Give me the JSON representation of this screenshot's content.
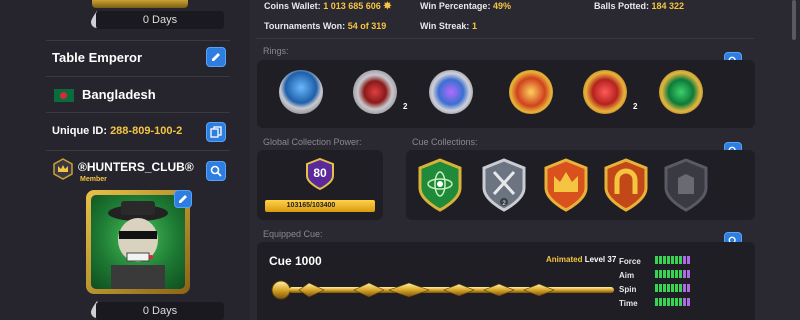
{
  "profile": {
    "days_top": "0 Days",
    "name": "Table Emperor",
    "country": "Bangladesh",
    "unique_id_label": "Unique ID:",
    "unique_id": "288-809-100-2",
    "club_name": "®HUNTERS_CLUB®",
    "club_role": "Member",
    "days_bottom": "0 Days"
  },
  "stats": {
    "coins_label": "Coins Wallet:",
    "coins_value": "1 013 685 606",
    "win_pct_label": "Win Percentage:",
    "win_pct_value": "49%",
    "balls_label": "Balls Potted:",
    "balls_value": "184 322",
    "tourn_label": "Tournaments Won:",
    "tourn_value": "54 of 319",
    "streak_label": "Win Streak:",
    "streak_value": "1"
  },
  "sections": {
    "rings": "Rings:",
    "power": "Global Collection Power:",
    "cue_collections": "Cue Collections:",
    "equipped_cue": "Equipped Cue:"
  },
  "rings": [
    {
      "name": "ring-8ball",
      "count": ""
    },
    {
      "name": "ring-silver",
      "count": "2"
    },
    {
      "name": "ring-galaxy",
      "count": ""
    },
    {
      "name": "ring-gold-dice",
      "count": ""
    },
    {
      "name": "ring-gold-heart",
      "count": "2"
    },
    {
      "name": "ring-emerald",
      "count": ""
    }
  ],
  "power": {
    "level": "80",
    "progress_text": "103165/103400",
    "progress": 0.998
  },
  "cue": {
    "name": "Cue 1000",
    "animated_label": "Animated",
    "level_label": "Level 37",
    "attrs": [
      {
        "label": "Force",
        "filled": 7,
        "total": 9
      },
      {
        "label": "Aim",
        "filled": 7,
        "total": 9
      },
      {
        "label": "Spin",
        "filled": 7,
        "total": 9
      },
      {
        "label": "Time",
        "filled": 7,
        "total": 9
      }
    ]
  },
  "colors": {
    "accent_blue": "#2e7de0",
    "gold": "#f5c542",
    "bar_green": "#39d353",
    "bar_purple": "#b06ae8"
  }
}
